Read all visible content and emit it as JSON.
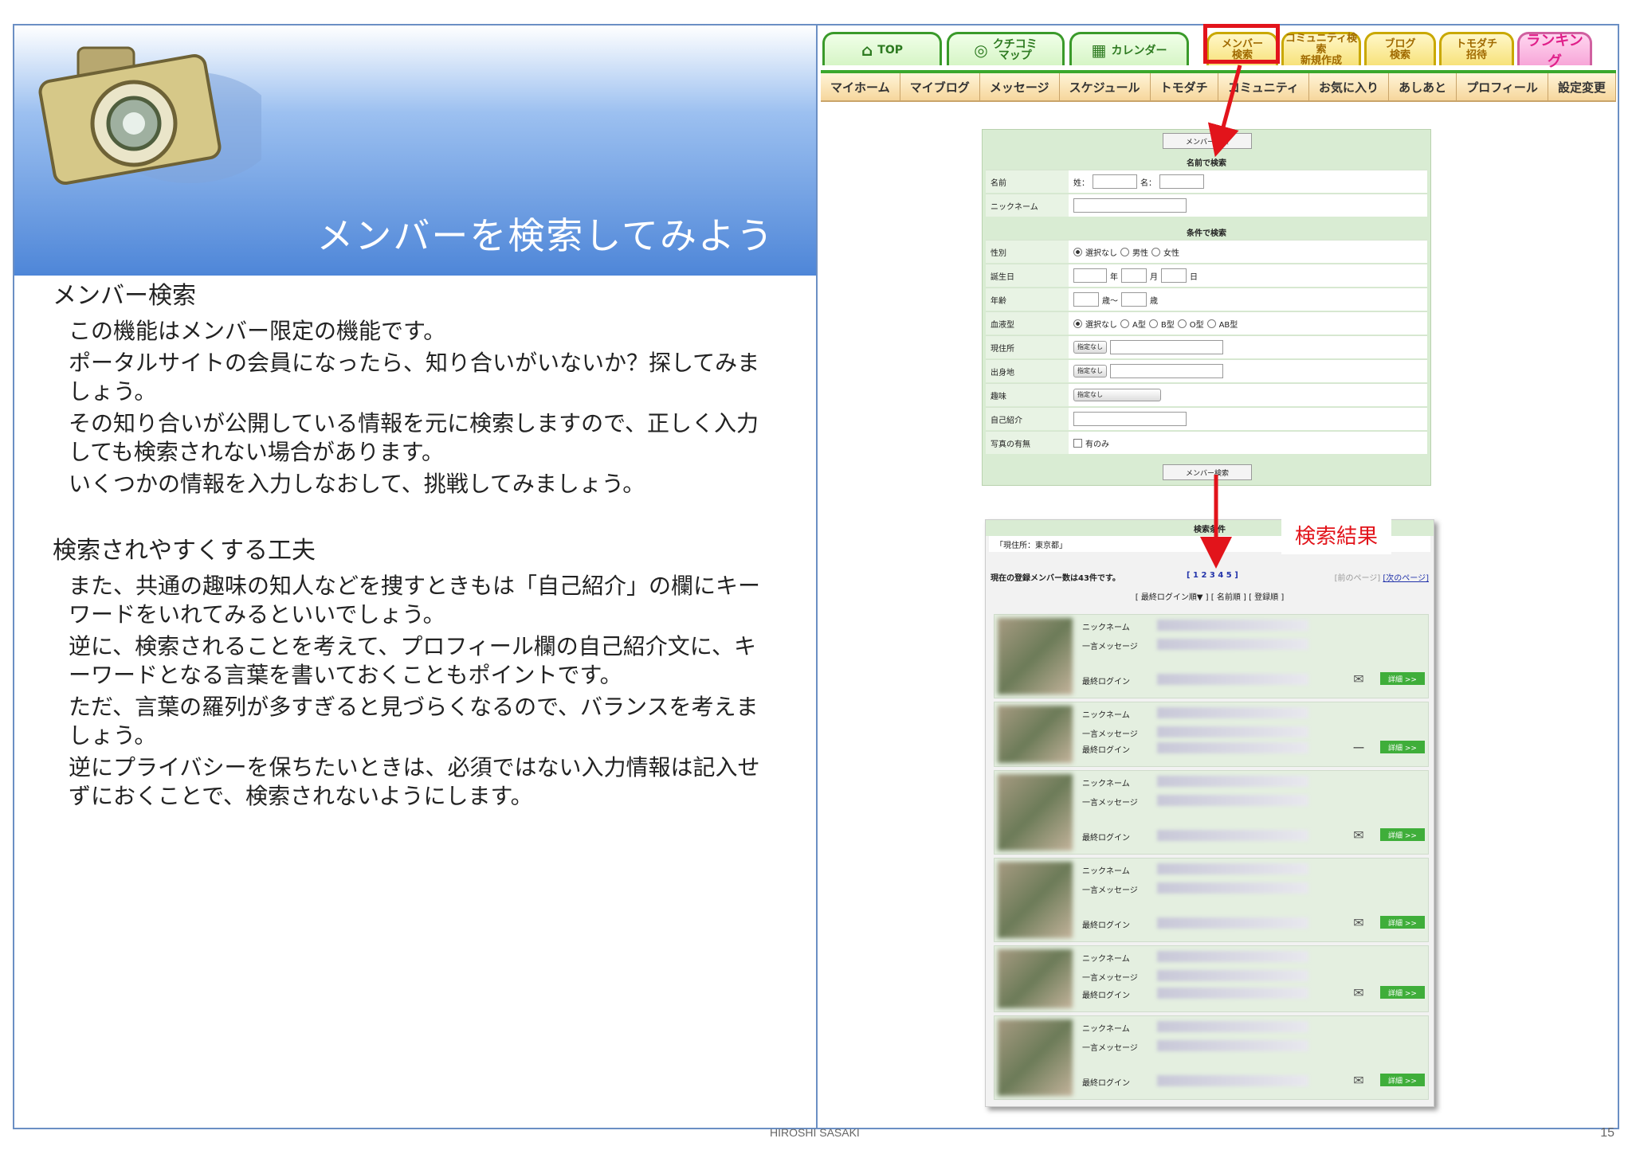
{
  "slide": {
    "title": "メンバーを検索してみよう",
    "section1": {
      "heading": "メンバー検索",
      "paragraphs": [
        "この機能はメンバー限定の機能です。",
        "ポータルサイトの会員になったら、知り合いがいないか？探してみましょう。",
        "その知り合いが公開している情報を元に検索しますので、正しく入力しても検索されない場合があります。",
        "いくつかの情報を入力しなおして、挑戦してみましょう。"
      ]
    },
    "section2": {
      "heading": "検索されやすくする工夫",
      "paragraphs": [
        "また、共通の趣味の知人などを捜すときもは「自己紹介」の欄にキーワードをいれてみるといいでしょう。",
        "逆に、検索されることを考えて、プロフィール欄の自己紹介文に、キーワードとなる言葉を書いておくこともポイントです。",
        "ただ、言葉の羅列が多すぎると見づらくなるので、バランスを考えましょう。",
        "逆にプライバシーを保ちたいときは、必須ではない入力情報は記入せずにおくことで、検索されないようにします。"
      ]
    },
    "footer_name": "HIROSHI SASAKI",
    "page_number": "15"
  },
  "nav": {
    "top": "TOP",
    "kuchikomi": [
      "クチコミ",
      "マップ"
    ],
    "calendar": "カレンダー",
    "member_search": [
      "メンバー",
      "検索"
    ],
    "community": [
      "コミュニティ検索",
      "新規作成"
    ],
    "blog": [
      "ブログ",
      "検索"
    ],
    "tomodachi": [
      "トモダチ",
      "招待"
    ],
    "ranking": "ランキング"
  },
  "sub_nav": [
    "マイホーム",
    "マイブログ",
    "メッセージ",
    "スケジュール",
    "トモダチ",
    "コミュニティ",
    "お気に入り",
    "あしあと",
    "プロフィール",
    "設定変更"
  ],
  "form": {
    "top_button": "メンバー検索",
    "name_section": "名前で検索",
    "name_label": "名前",
    "sei": "姓：",
    "mei": "名：",
    "nickname_label": "ニックネーム",
    "cond_section": "条件で検索",
    "gender_label": "性別",
    "gender_options": [
      "選択なし",
      "男性",
      "女性"
    ],
    "birthday_label": "誕生日",
    "year": "年",
    "month": "月",
    "day": "日",
    "age_label": "年齢",
    "age_from": "歳～",
    "age_to": "歳",
    "blood_label": "血液型",
    "blood_options": [
      "選択なし",
      "A型",
      "B型",
      "O型",
      "AB型"
    ],
    "residence_label": "現住所",
    "hometown_label": "出身地",
    "hobby_label": "趣味",
    "unspecified": "指定なし",
    "intro_label": "自己紹介",
    "photo_label": "写真の有無",
    "photo_only": "有のみ",
    "bottom_button": "メンバー検索"
  },
  "result": {
    "label": "検索結果",
    "cond_title": "検索条件",
    "cond_value": "「現住所：東京都」",
    "count_text": "現在の登録メンバー数は43件です。",
    "pager": "[ 1 2 3 4 5 ]",
    "prev_page": "[前のページ]",
    "next_page": "[次のページ]",
    "sort_text": "[ 最終ログイン順▼ ] [ 名前順 ] [ 登録順 ]",
    "row_labels": [
      "ニックネーム",
      "一言メッセージ",
      "最終ログイン"
    ],
    "detail_label": "詳細 >>",
    "members": [
      {
        "mail": "✉"
      },
      {
        "mail": "ー"
      },
      {
        "mail": "✉"
      },
      {
        "mail": "✉"
      },
      {
        "mail": "✉"
      },
      {
        "mail": "✉"
      }
    ]
  },
  "colors": {
    "frame": "#6b8fc4",
    "accent_red": "#e2141b",
    "nav_green": "#3aa82c"
  }
}
